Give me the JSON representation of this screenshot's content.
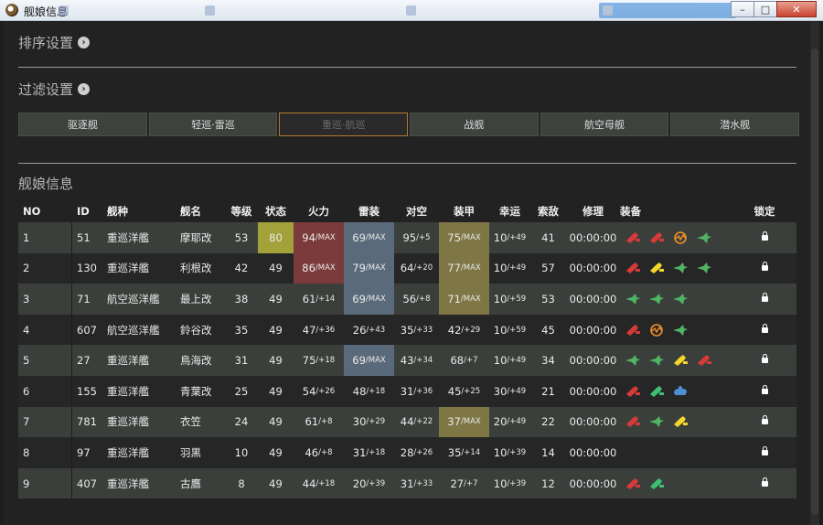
{
  "window": {
    "title": "舰娘信息"
  },
  "sort": {
    "title": "排序设置"
  },
  "filter": {
    "title": "过滤设置",
    "buttons": [
      "驱逐舰",
      "轻巡·雷巡",
      "重巡·航巡",
      "战舰",
      "航空母舰",
      "潜水舰"
    ],
    "active_index": 2
  },
  "table": {
    "title": "舰娘信息",
    "headers": [
      "NO",
      "ID",
      "舰种",
      "舰名",
      "等级",
      "状态",
      "火力",
      "雷装",
      "对空",
      "装甲",
      "幸运",
      "索敌",
      "修理",
      "装备",
      "锁定"
    ],
    "rows": [
      {
        "no": "1",
        "id": "51",
        "type": "重巡洋艦",
        "name": "摩耶改",
        "lv": "53",
        "status": "80",
        "fp": "94/MAX",
        "tp": "69/MAX",
        "aa": "95/+5",
        "ar": "75/MAX",
        "lk": "10/+49",
        "los": "41",
        "repair": "00:00:00",
        "equip": [
          "red-gun-icon",
          "red-gun-icon",
          "radar-orange-icon",
          "green-plane-icon"
        ],
        "hl": {
          "status": true,
          "fp": true,
          "tp": true,
          "ar": true
        }
      },
      {
        "no": "2",
        "id": "130",
        "type": "重巡洋艦",
        "name": "利根改",
        "lv": "42",
        "status": "49",
        "fp": "86/MAX",
        "tp": "79/MAX",
        "aa": "64/+20",
        "ar": "77/MAX",
        "lk": "10/+49",
        "los": "57",
        "repair": "00:00:00",
        "equip": [
          "red-gun-icon",
          "yellow-gun-icon",
          "green-plane-icon",
          "green-plane-icon"
        ],
        "hl": {
          "fp": true,
          "tp": true,
          "ar": true
        }
      },
      {
        "no": "3",
        "id": "71",
        "type": "航空巡洋艦",
        "name": "最上改",
        "lv": "38",
        "status": "49",
        "fp": "61/+14",
        "tp": "69/MAX",
        "aa": "56/+8",
        "ar": "71/MAX",
        "lk": "10/+59",
        "los": "53",
        "repair": "00:00:00",
        "equip": [
          "green-plane-icon",
          "green-plane-icon",
          "green-plane-icon"
        ],
        "hl": {
          "tp": true,
          "ar": true
        }
      },
      {
        "no": "4",
        "id": "607",
        "type": "航空巡洋艦",
        "name": "鈴谷改",
        "lv": "35",
        "status": "49",
        "fp": "47/+36",
        "tp": "26/+43",
        "aa": "35/+33",
        "ar": "42/+29",
        "lk": "10/+59",
        "los": "45",
        "repair": "00:00:00",
        "equip": [
          "red-gun-icon",
          "radar-orange-icon",
          "green-plane-icon"
        ],
        "hl": {}
      },
      {
        "no": "5",
        "id": "27",
        "type": "重巡洋艦",
        "name": "鳥海改",
        "lv": "31",
        "status": "49",
        "fp": "75/+18",
        "tp": "69/MAX",
        "aa": "43/+34",
        "ar": "68/+7",
        "lk": "10/+49",
        "los": "34",
        "repair": "00:00:00",
        "equip": [
          "green-plane-icon",
          "green-plane-icon",
          "yellow-gun-icon",
          "red-gun-icon"
        ],
        "hl": {
          "tp": true
        }
      },
      {
        "no": "6",
        "id": "155",
        "type": "重巡洋艦",
        "name": "青葉改",
        "lv": "25",
        "status": "49",
        "fp": "54/+26",
        "tp": "48/+18",
        "aa": "31/+36",
        "ar": "45/+25",
        "lk": "30/+49",
        "los": "21",
        "repair": "00:00:00",
        "equip": [
          "red-gun-icon",
          "green-gun-icon",
          "blue-part-icon"
        ],
        "hl": {}
      },
      {
        "no": "7",
        "id": "781",
        "type": "重巡洋艦",
        "name": "衣笠",
        "lv": "24",
        "status": "49",
        "fp": "61/+8",
        "tp": "30/+29",
        "aa": "44/+22",
        "ar": "37/MAX",
        "lk": "20/+49",
        "los": "22",
        "repair": "00:00:00",
        "equip": [
          "red-gun-icon",
          "green-plane-icon",
          "yellow-gun-icon"
        ],
        "hl": {
          "ar": true
        }
      },
      {
        "no": "8",
        "id": "97",
        "type": "重巡洋艦",
        "name": "羽黒",
        "lv": "10",
        "status": "49",
        "fp": "46/+8",
        "tp": "31/+18",
        "aa": "28/+26",
        "ar": "35/+14",
        "lk": "10/+39",
        "los": "14",
        "repair": "00:00:00",
        "equip": [],
        "hl": {}
      },
      {
        "no": "9",
        "id": "407",
        "type": "重巡洋艦",
        "name": "古鷹",
        "lv": "8",
        "status": "49",
        "fp": "44/+18",
        "tp": "20/+39",
        "aa": "31/+33",
        "ar": "27/+7",
        "lk": "10/+39",
        "los": "12",
        "repair": "00:00:00",
        "equip": [
          "red-gun-icon",
          "green-gun-icon"
        ],
        "hl": {}
      }
    ]
  },
  "colors": {
    "highlight_status": "#a3a13a",
    "highlight_fp": "#7c3b3b",
    "highlight_tp": "#5b6a7a",
    "highlight_ar": "#7e7645"
  }
}
